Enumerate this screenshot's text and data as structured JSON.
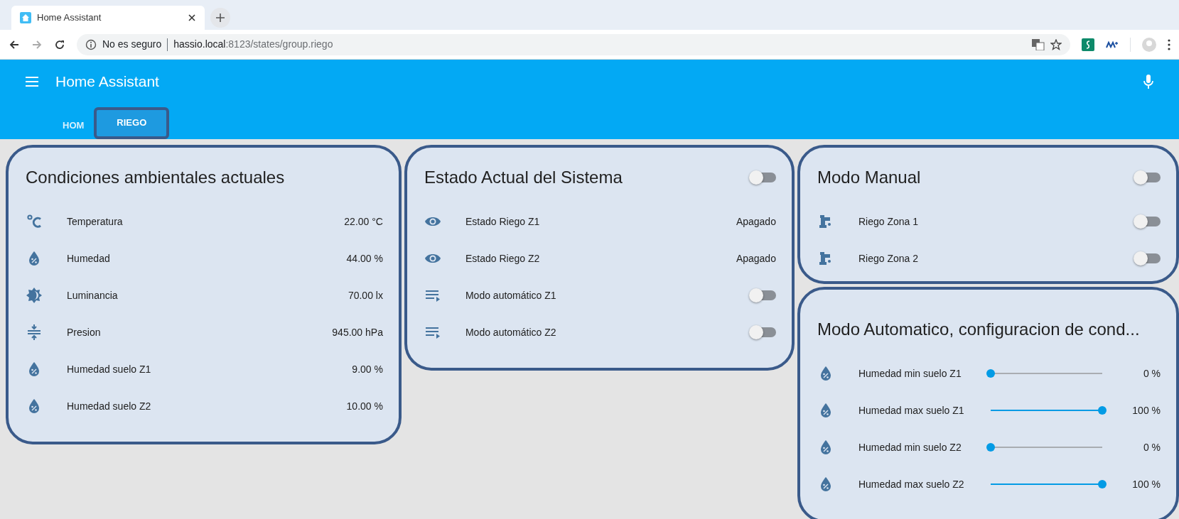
{
  "browser": {
    "tab_title": "Home Assistant",
    "security": "No es seguro",
    "url_host": "hassio.local",
    "url_path": ":8123/states/group.riego"
  },
  "app": {
    "title": "Home Assistant",
    "tabs": [
      {
        "label": "HOM",
        "selected": false
      },
      {
        "label": "RIEGO",
        "selected": true
      }
    ]
  },
  "cards": [
    {
      "title": "Condiciones ambientales actuales",
      "rows": [
        {
          "kind": "sensor",
          "label": "Temperatura",
          "value": "22.00 °C"
        },
        {
          "kind": "sensor",
          "label": "Humedad",
          "value": "44.00 %"
        },
        {
          "kind": "sensor",
          "label": "Luminancia",
          "value": "70.00 lx"
        },
        {
          "kind": "sensor",
          "label": "Presion",
          "value": "945.00 hPa"
        },
        {
          "kind": "sensor",
          "label": "Humedad suelo Z1",
          "value": "9.00 %"
        },
        {
          "kind": "sensor",
          "label": "Humedad suelo Z2",
          "value": "10.00 %"
        }
      ]
    },
    {
      "title": "Estado Actual del Sistema",
      "header_toggle": {
        "on": false
      },
      "rows": [
        {
          "kind": "sensor",
          "label": "Estado Riego Z1",
          "value": "Apagado"
        },
        {
          "kind": "sensor",
          "label": "Estado Riego Z2",
          "value": "Apagado"
        },
        {
          "kind": "toggle",
          "label": "Modo automático Z1",
          "on": false
        },
        {
          "kind": "toggle",
          "label": "Modo automático Z2",
          "on": false
        }
      ]
    },
    {
      "title": "Modo Manual",
      "header_toggle": {
        "on": false
      },
      "rows": [
        {
          "kind": "toggle",
          "label": "Riego Zona 1",
          "on": false
        },
        {
          "kind": "toggle",
          "label": "Riego Zona 2",
          "on": false
        }
      ]
    },
    {
      "title": "Modo Automatico, configuracion de cond...",
      "rows": [
        {
          "kind": "slider",
          "label": "Humedad min suelo Z1",
          "level": 0,
          "reading": "0 %"
        },
        {
          "kind": "slider",
          "label": "Humedad max suelo Z1",
          "level": 1,
          "reading": "100 %"
        },
        {
          "kind": "slider",
          "label": "Humedad min suelo Z2",
          "level": 0,
          "reading": "0 %"
        },
        {
          "kind": "slider",
          "label": "Humedad max suelo Z2",
          "level": 1,
          "reading": "100 %"
        }
      ]
    }
  ]
}
